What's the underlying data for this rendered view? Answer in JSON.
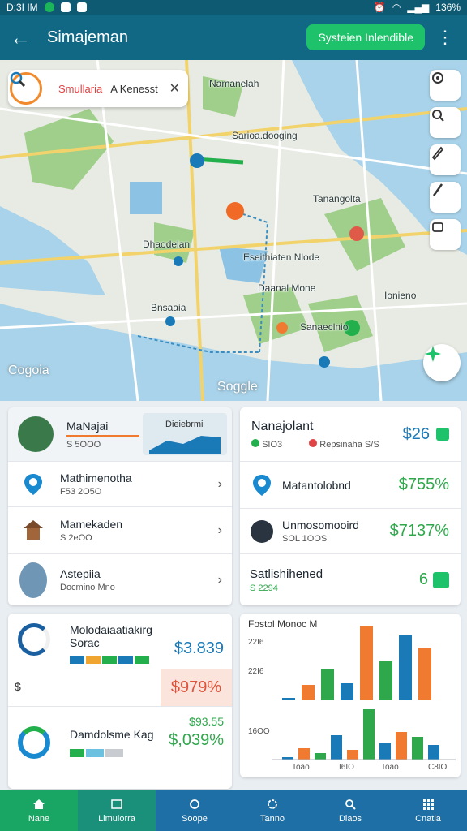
{
  "status_bar": {
    "time": "D:3I IM",
    "battery": "136%"
  },
  "app_bar": {
    "title": "Simajeman",
    "system_button": "Systeien Inlendible"
  },
  "map": {
    "search_chip": {
      "label": "Smullaria",
      "label2": "A Kenesst"
    },
    "labels": [
      "Namanelah",
      "Sarioa.dooging",
      "Tanangolta",
      "Dhaodelan",
      "Eseithiaten Nlode",
      "Daanal Mone",
      "Ionieno",
      "Bnsaaia",
      "Sanaeclnio"
    ],
    "watermark_left": "Cogoia",
    "watermark_center": "Soggle",
    "tools": [
      "settings-icon",
      "search-icon",
      "pencil-icon",
      "brush-icon",
      "layers-icon"
    ]
  },
  "left_top": {
    "header": {
      "title": "MaNajai",
      "sub": "S 5OOO",
      "chart_label": "Dieiebrmi"
    },
    "rows": [
      {
        "title": "Mathimenotha",
        "sub": "F53 2O5O"
      },
      {
        "title": "Mamekaden",
        "sub": "S 2eOO"
      },
      {
        "title": "Astepiia",
        "sub": "Docmino Mno"
      }
    ]
  },
  "right_top": {
    "header": {
      "title": "Nanajolant",
      "sub": "SIO3",
      "sub2": "Repsinaha",
      "sub3": "S/S",
      "value": "$26"
    },
    "rows": [
      {
        "title": "Matantolobnd",
        "sub": "",
        "value": "$755%"
      },
      {
        "title": "Unmosomooird",
        "sub": "SOL 1OOS",
        "value": "$7137%"
      },
      {
        "title": "Satlishihened",
        "sub": "S 2294",
        "value": "6"
      }
    ]
  },
  "left_bottom": {
    "items": [
      {
        "title": "Molodaiaatiakirg",
        "sub": "Sorac",
        "value": "$3.839",
        "badge": "$979%",
        "mark": "$"
      },
      {
        "title": "Damdolsme Kag",
        "sub": "",
        "value": "$93.55",
        "value2": "$,039%"
      }
    ]
  },
  "chart_data": {
    "type": "bar",
    "title": "Fostol Monoc M",
    "y_ticks": [
      "22I6",
      "22I6",
      "16OO"
    ],
    "x_ticks": [
      "Toao",
      "I6IO",
      "Toao",
      "C8IO"
    ],
    "colors": [
      "#1a7ab8",
      "#f07a30",
      "#2ea84b"
    ],
    "top_series": [
      {
        "name": "",
        "values": [
          2,
          18,
          38,
          20,
          90,
          48,
          80,
          64
        ]
      },
      {
        "name": "",
        "values": [
          0,
          0,
          0,
          0,
          0,
          0,
          0,
          0
        ]
      }
    ]
  },
  "bottom_nav": {
    "items": [
      {
        "label": "Nane",
        "active": true
      },
      {
        "label": "Llmulorra",
        "active": false
      },
      {
        "label": "Soope",
        "active": false
      },
      {
        "label": "Tanno",
        "active": false
      },
      {
        "label": "Dlaos",
        "active": false
      },
      {
        "label": "Cnatia",
        "active": false
      }
    ]
  }
}
